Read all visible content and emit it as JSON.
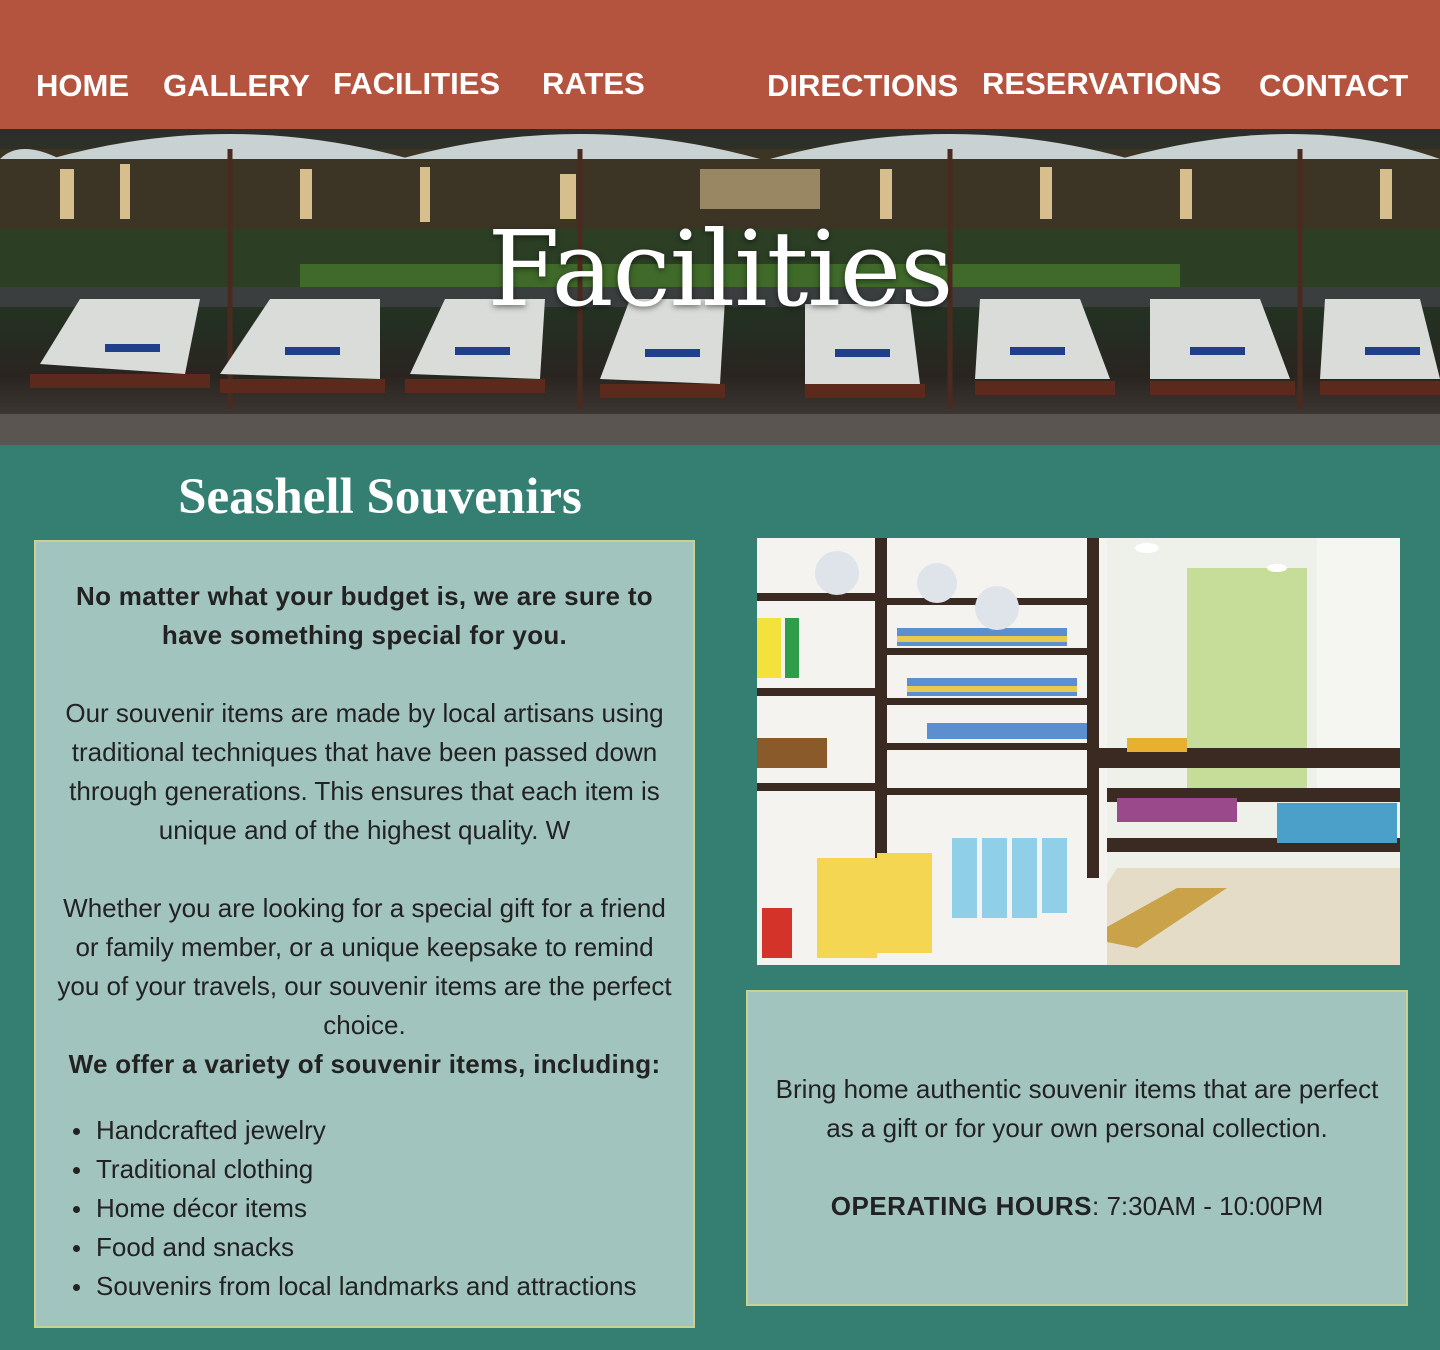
{
  "nav": {
    "home": "HOME",
    "gallery": "GALLERY",
    "facilities": "FACILITIES",
    "rates": "RATES",
    "directions": "DIRECTIONS",
    "reservations": "RESERVATIONS",
    "contact": "CONTACT"
  },
  "hero": {
    "title": "Facilities"
  },
  "section": {
    "title": "Seashell Souvenirs"
  },
  "info": {
    "lead_line1": "No matter what your budget is, we are sure to",
    "lead_line2": "have something special for you.",
    "p1_lines": [
      "Our souvenir items are made by local artisans using",
      "traditional techniques that have been passed down",
      "through generations. This ensures that each item is",
      "unique and of the highest quality. W"
    ],
    "p2_lines": [
      "Whether you are looking for a special gift for a friend",
      "or family member, or a unique keepsake to remind",
      "you of your travels, our souvenir items are the perfect",
      "choice."
    ],
    "offer_heading": "We offer a variety of souvenir items, including:",
    "items": [
      "Handcrafted jewelry",
      "Traditional clothing",
      "Home décor items",
      "Food and snacks",
      "Souvenirs from local landmarks and attractions"
    ]
  },
  "hours": {
    "line1": "Bring home authentic souvenir items that are perfect",
    "line2": "as a gift or for your own personal collection.",
    "label": "OPERATING HOURS",
    "value": ": 7:30AM - 10:00PM"
  },
  "colors": {
    "nav_bg": "#b4543f",
    "page_bg": "#347f72",
    "card_bg": "#a2c4bf",
    "card_border": "#c8d28e"
  }
}
